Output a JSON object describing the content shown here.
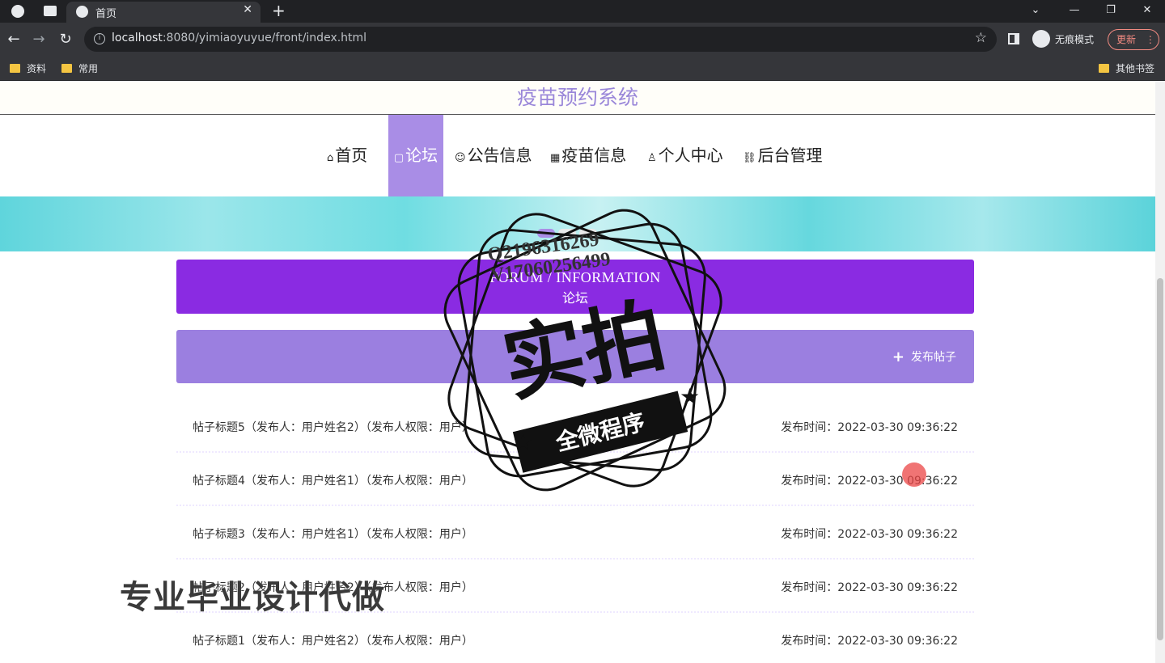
{
  "browser": {
    "tab_title": "首页",
    "tab_close": "✕",
    "new_tab": "+",
    "url_host": "localhost",
    "url_rest": ":8080/yimiaoyuyue/front/index.html",
    "incognito_label": "无痕模式",
    "update_label": "更新",
    "bookmarks": [
      "资料",
      "常用"
    ],
    "other_bookmarks": "其他书签",
    "window_controls": [
      "⌄",
      "—",
      "❐",
      "✕"
    ]
  },
  "site": {
    "title": "疫苗预约系统",
    "menu": [
      {
        "icon": "⌂",
        "label": "首页",
        "active": false
      },
      {
        "icon": "▢",
        "label": "论坛",
        "active": true
      },
      {
        "icon": "☺",
        "label": "公告信息",
        "active": false
      },
      {
        "icon": "▦",
        "label": "疫苗信息",
        "active": false
      },
      {
        "icon": "♙",
        "label": "个人中心",
        "active": false
      },
      {
        "icon": "⛓",
        "label": "后台管理",
        "active": false
      }
    ]
  },
  "section": {
    "title_en": "FORUM / INFORMATION",
    "title_zh": "论坛",
    "post_button": "发布帖子"
  },
  "posts": [
    {
      "title": "帖子标题5（发布人：用户姓名2）（发布人权限：用户）",
      "time": "发布时间：2022-03-30 09:36:22"
    },
    {
      "title": "帖子标题4（发布人：用户姓名1）（发布人权限：用户）",
      "time": "发布时间：2022-03-30 09:36:22"
    },
    {
      "title": "帖子标题3（发布人：用户姓名1）（发布人权限：用户）",
      "time": "发布时间：2022-03-30 09:36:22"
    },
    {
      "title": "帖子标题2（发布人：用户姓名2）（发布人权限：用户）",
      "time": "发布时间：2022-03-30 09:36:22"
    },
    {
      "title": "帖子标题1（发布人：用户姓名2）（发布人权限：用户）",
      "time": "发布时间：2022-03-30 09:36:22"
    }
  ],
  "overlay": {
    "stamp_main": "实拍",
    "stamp_banner": "全微程序",
    "contact_q": "Q2196316269",
    "contact_v": "V17060256499",
    "watermark": "专业毕业设计代做"
  },
  "colors": {
    "accent": "#a98de6",
    "section_head": "#8a2be2",
    "action_bar": "#9b7fe0",
    "banner": "#5fd5dc"
  }
}
